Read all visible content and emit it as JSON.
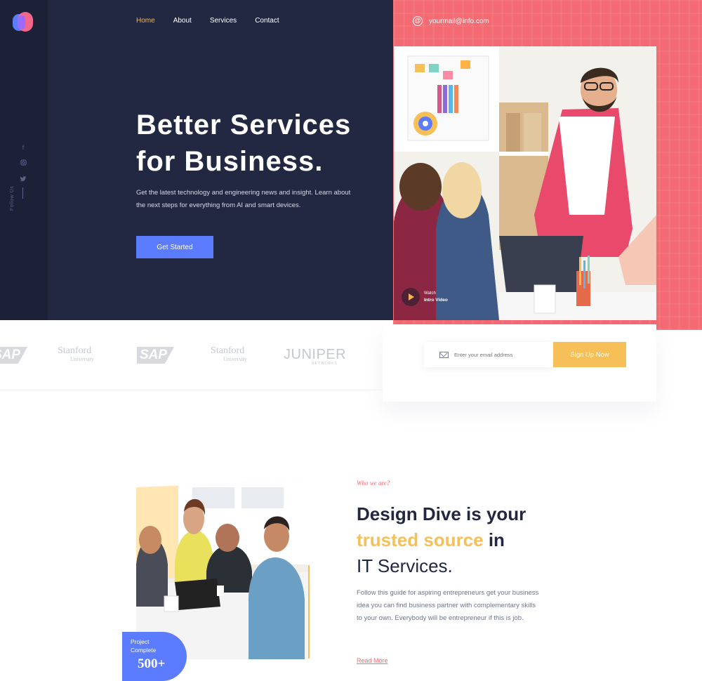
{
  "nav": {
    "items": [
      {
        "label": "Home",
        "active": true
      },
      {
        "label": "About",
        "active": false
      },
      {
        "label": "Services",
        "active": false
      },
      {
        "label": "Contact",
        "active": false
      }
    ]
  },
  "contact": {
    "email": "yourmail@info.com"
  },
  "social": {
    "icons": [
      "facebook-icon",
      "instagram-icon",
      "twitter-icon"
    ],
    "label": "Follow Us"
  },
  "hero": {
    "title_line1": "Better Services",
    "title_line2": "for Business.",
    "description": "Get the latest technology and engineering news and insight. Learn about the next steps for everything from AI and smart devices.",
    "cta_label": "Get Started",
    "video_small": "Watch",
    "video_label": "Intro Video"
  },
  "brands": {
    "items": [
      "SAP",
      "Stanford",
      "SAP",
      "Stanford",
      "JUNIPER"
    ],
    "stanford_sub": "University",
    "juniper_sub": "NETWORKS"
  },
  "signup": {
    "placeholder": "Enter your email address",
    "button_label": "Sign Up Now"
  },
  "about": {
    "kicker": "Who we are?",
    "title_part1": "Design Dive is your",
    "title_accent": "trusted source",
    "title_part2": " in",
    "title_line3": "IT Services.",
    "description": "Follow this guide for aspiring entrepreneurs get your business idea you can find business partner with complementary skills to your own. Everybody will be entrepreneur if this is job.",
    "read_more": "Read More",
    "stat_label1": "Project",
    "stat_label2": "Complete",
    "stat_value": "500+"
  },
  "colors": {
    "dark": "#232842",
    "coral": "#f36a72",
    "blue": "#5b7cff",
    "yellow": "#f6bf58"
  }
}
